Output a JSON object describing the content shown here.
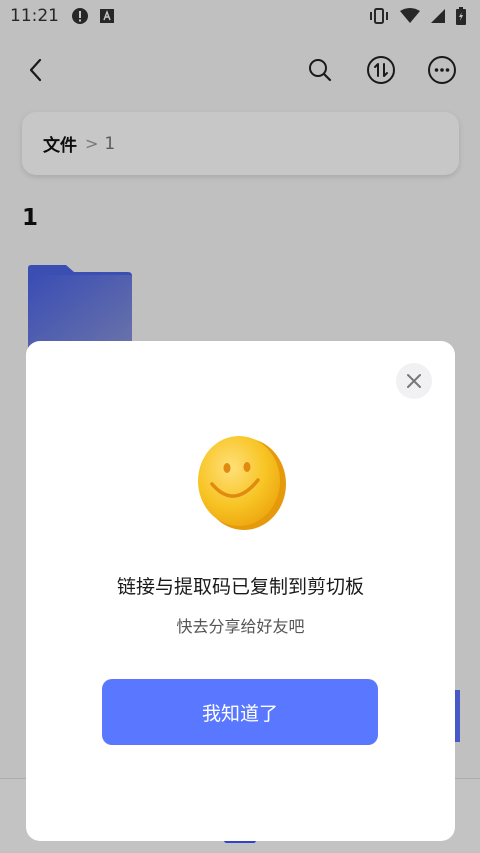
{
  "status_bar": {
    "time": "11:21",
    "icons": [
      "alert-icon",
      "a-badge-icon",
      "vibrate-icon",
      "wifi-icon",
      "signal-icon",
      "battery-icon"
    ]
  },
  "toolbar": {
    "icons": [
      "back-icon",
      "search-icon",
      "sort-icon",
      "more-icon"
    ]
  },
  "breadcrumb": {
    "root": "文件",
    "separator": ">",
    "current": "1"
  },
  "folder": {
    "title": "1"
  },
  "dialog": {
    "title": "链接与提取码已复制到剪切板",
    "subtitle": "快去分享给好友吧",
    "confirm_label": "我知道了"
  },
  "colors": {
    "accent": "#5a78ff",
    "emoji": "#f6c01e"
  }
}
